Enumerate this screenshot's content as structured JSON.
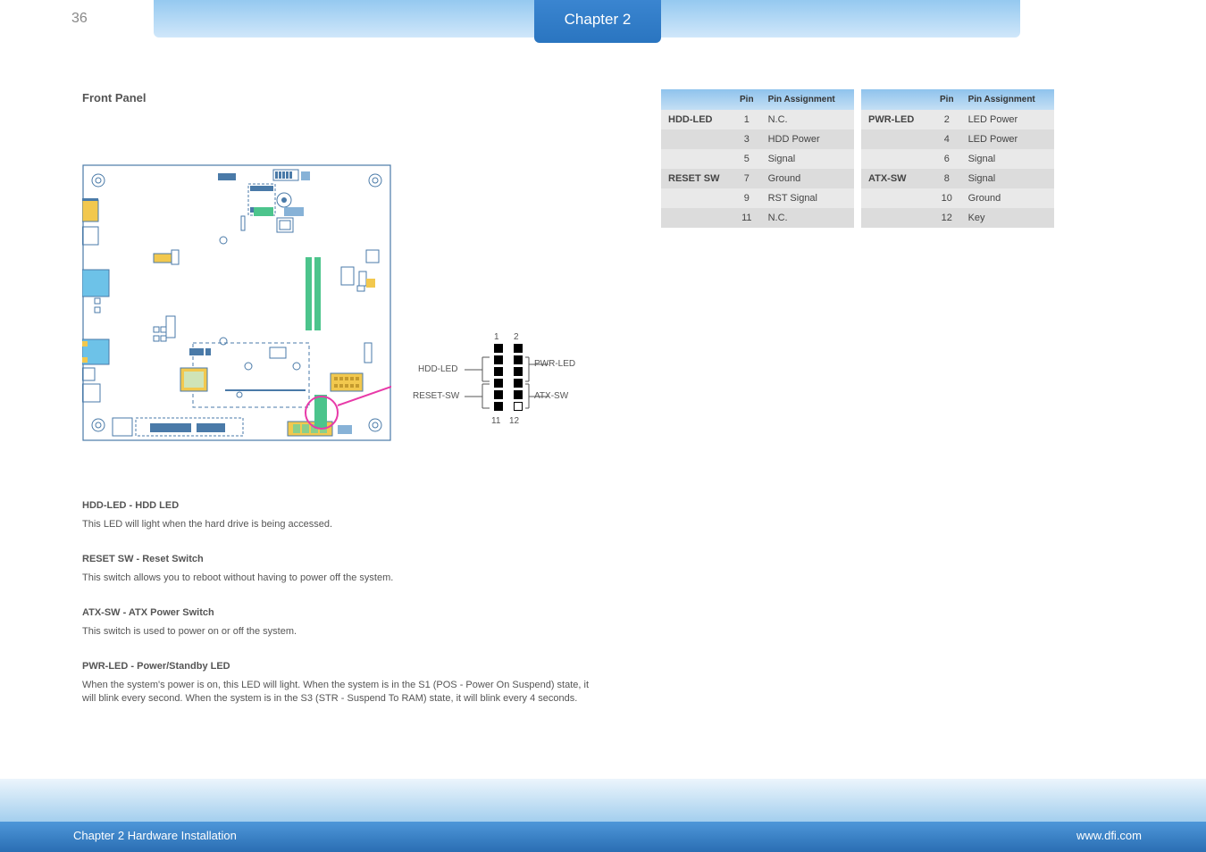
{
  "page_number": "36",
  "chapter_tab": "Chapter 2",
  "headings": {
    "main": "Front Panel",
    "hdd_led": "HDD-LED - HDD LED",
    "hdd_led_text": "This LED will light when the hard drive is being accessed.",
    "reset_sw": "RESET SW - Reset Switch",
    "reset_sw_text": "This switch allows you to reboot without having to power off the system.",
    "atx_sw": "ATX-SW - ATX Power Switch",
    "atx_sw_text": "This switch is used to power on or off the system.",
    "pwr_led": "PWR-LED - Power/Standby LED",
    "pwr_led_text": "When the system's power is on, this LED will light. When the system is in the S1 (POS - Power On Suspend) state, it will blink every second. When the system is in the S3 (STR - Suspend To RAM) state, it will blink every 4 seconds."
  },
  "header_zoom": {
    "hdd": "HDD-LED",
    "reset": "RESET-SW",
    "pwr": "PWR-LED",
    "atx": "ATX-SW",
    "n1": "1",
    "n2": "2",
    "n11": "11",
    "n12": "12"
  },
  "table": {
    "cols": [
      "",
      "Pin",
      "Pin Assignment",
      "",
      "Pin",
      "Pin Assignment"
    ],
    "rows": [
      {
        "fn_l": "HDD-LED",
        "pin_l": "1",
        "asg_l": "N.C.",
        "fn_r": "PWR-LED",
        "pin_r": "2",
        "asg_r": "LED Power"
      },
      {
        "fn_l": "",
        "pin_l": "3",
        "asg_l": "HDD Power",
        "fn_r": "",
        "pin_r": "4",
        "asg_r": "LED Power"
      },
      {
        "fn_l": "",
        "pin_l": "5",
        "asg_l": "Signal",
        "fn_r": "",
        "pin_r": "6",
        "asg_r": "Signal"
      },
      {
        "fn_l": "RESET SW",
        "pin_l": "7",
        "asg_l": "Ground",
        "fn_r": "ATX-SW",
        "pin_r": "8",
        "asg_r": "Signal"
      },
      {
        "fn_l": "",
        "pin_l": "9",
        "asg_l": "RST Signal",
        "fn_r": "",
        "pin_r": "10",
        "asg_r": "Ground"
      },
      {
        "fn_l": "",
        "pin_l": "11",
        "asg_l": "N.C.",
        "fn_r": "",
        "pin_r": "12",
        "asg_r": "Key"
      }
    ]
  },
  "footer": {
    "left": "Chapter 2 Hardware Installation",
    "right": "www.dfi.com"
  }
}
